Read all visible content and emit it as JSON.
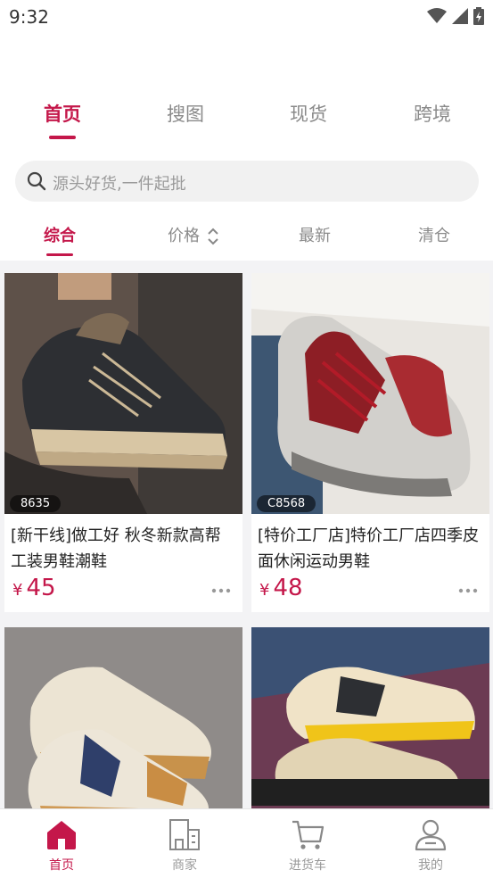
{
  "status_bar": {
    "time": "9:32"
  },
  "top_tabs": [
    {
      "label": "首页",
      "active": true
    },
    {
      "label": "搜图",
      "active": false
    },
    {
      "label": "现货",
      "active": false
    },
    {
      "label": "跨境",
      "active": false
    }
  ],
  "search": {
    "placeholder": "源头好货,一件起批"
  },
  "filter_tabs": [
    {
      "label": "综合",
      "active": true
    },
    {
      "label": "价格",
      "active": false,
      "icon": "sort-updown-icon"
    },
    {
      "label": "最新",
      "active": false
    },
    {
      "label": "清仓",
      "active": false
    }
  ],
  "products": [
    {
      "code": "8635",
      "title": "[新干线]做工好 秋冬新款高帮工装男鞋潮鞋",
      "currency": "¥",
      "price": "45"
    },
    {
      "code": "C8568",
      "title": "[特价工厂店]特价工厂店四季皮面休闲运动男鞋",
      "currency": "¥",
      "price": "48"
    },
    {
      "code": "",
      "title": "",
      "currency": "",
      "price": ""
    },
    {
      "code": "",
      "title": "",
      "currency": "",
      "price": ""
    }
  ],
  "bottom_nav": [
    {
      "label": "首页",
      "icon": "home-icon",
      "active": true
    },
    {
      "label": "商家",
      "icon": "store-icon",
      "active": false
    },
    {
      "label": "进货车",
      "icon": "cart-icon",
      "active": false
    },
    {
      "label": "我的",
      "icon": "profile-icon",
      "active": false
    }
  ],
  "colors": {
    "accent": "#c4174a",
    "inactive": "#8a8a8a"
  }
}
